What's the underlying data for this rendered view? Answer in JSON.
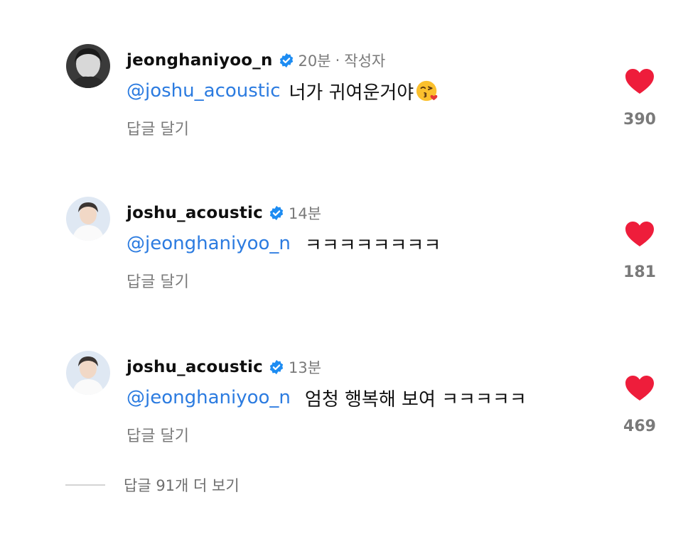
{
  "comments": [
    {
      "username": "jeonghaniyoo_n",
      "time": "20분",
      "author_tag": "작성자",
      "mention": "@joshu_acoustic",
      "text": "너가 귀여운거야",
      "emoji": "face-blowing-kiss-icon",
      "reply_label": "답글 달기",
      "likes": "390"
    },
    {
      "username": "joshu_acoustic",
      "time": "14분",
      "mention": "@jeonghaniyoo_n",
      "text": "ㅋㅋㅋㅋㅋㅋㅋㅋ",
      "reply_label": "답글 달기",
      "likes": "181"
    },
    {
      "username": "joshu_acoustic",
      "time": "13분",
      "mention": "@jeonghaniyoo_n",
      "text": "엄청 행복해 보여 ㅋㅋㅋㅋㅋ",
      "reply_label": "답글 달기",
      "likes": "469"
    }
  ],
  "view_more_replies": "답글 91개 더 보기",
  "colors": {
    "mention": "#2b7be0",
    "heart": "#ee1d3b",
    "verified": "#1d8cf2",
    "muted": "#7a7a7a"
  }
}
